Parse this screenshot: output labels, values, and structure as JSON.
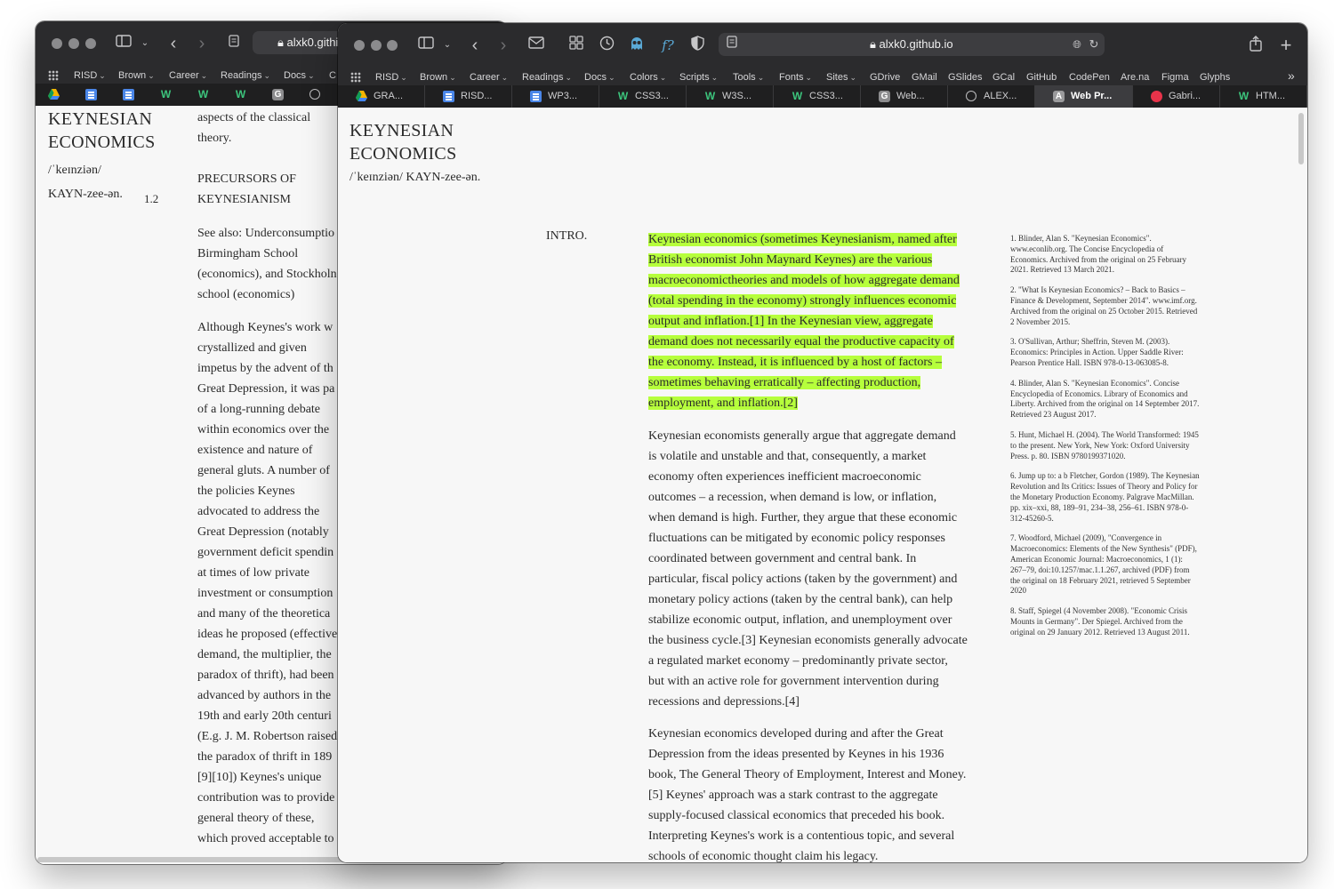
{
  "back_window": {
    "url": "alxk0.githi",
    "bookmarks": [
      "RISD",
      "Brown",
      "Career",
      "Readings",
      "Docs",
      "C"
    ],
    "title_lines": [
      "KEYNESIAN",
      "ECONOMICS"
    ],
    "pronunciation_lines": [
      "/ˈkeɪnziən/",
      "KAYN-zee-ən."
    ],
    "section_number": "1.2",
    "top_lines": [
      "aspects of the classical",
      "theory."
    ],
    "heading_lines": [
      "PRECURSORS OF",
      "KEYNESIANISM"
    ],
    "para1_lines": [
      "See also: Underconsumptio",
      "Birmingham School",
      "(economics), and Stockholn",
      "school (economics)"
    ],
    "para2_lines": [
      "Although Keynes's work w",
      "crystallized and given",
      "impetus by the advent of th",
      "Great Depression, it was pa",
      "of a long-running debate",
      "within economics over the",
      "existence and nature of",
      "general gluts. A number of",
      "the policies Keynes",
      "advocated to address the",
      "Great Depression (notably",
      "government deficit spendin",
      "at times of low private",
      "investment or consumption",
      "and many of the theoretica",
      "ideas he proposed (effective",
      "demand, the multiplier, the",
      "paradox of thrift), had been",
      "advanced by authors in the",
      "19th and early 20th centuri",
      "(E.g. J. M. Robertson raised",
      "the paradox of thrift in 189",
      "[9][10]) Keynes's unique",
      "contribution was to provide",
      "general theory of these,",
      "which proved acceptable to"
    ]
  },
  "front_window": {
    "url": "alxk0.github.io",
    "bookmarks": [
      "RISD",
      "Brown",
      "Career",
      "Readings",
      "Docs",
      "Colors",
      "Scripts",
      "Tools",
      "Fonts",
      "Sites",
      "GDrive",
      "GMail",
      "GSlides",
      "GCal",
      "GitHub",
      "CodePen",
      "Are.na",
      "Figma",
      "Glyphs"
    ],
    "bookmark_has_menu": [
      true,
      true,
      true,
      true,
      true,
      true,
      true,
      true,
      true,
      true,
      false,
      false,
      false,
      false,
      false,
      false,
      false,
      false,
      false
    ],
    "tabs": [
      {
        "label": "GRA...",
        "icon": "google-drive-icon"
      },
      {
        "label": "RISD...",
        "icon": "google-docs-icon"
      },
      {
        "label": "WP3...",
        "icon": "google-docs-icon"
      },
      {
        "label": "CSS3...",
        "icon": "w3schools-icon"
      },
      {
        "label": "W3S...",
        "icon": "w3schools-icon"
      },
      {
        "label": "CSS3...",
        "icon": "w3schools-icon"
      },
      {
        "label": "Web...",
        "icon": "g-letter-icon"
      },
      {
        "label": "ALEX...",
        "icon": "compass-icon"
      },
      {
        "label": "Web Pr...",
        "icon": "a-letter-icon"
      },
      {
        "label": "Gabri...",
        "icon": "red-circle-icon"
      },
      {
        "label": "HTM...",
        "icon": "w3schools-icon"
      }
    ],
    "title_lines": [
      "KEYNESIAN",
      "ECONOMICS"
    ],
    "pronunciation": "/ˈkeɪnziən/ KAYN-zee-ən.",
    "section_label": "INTRO.",
    "highlight_lines": [
      "Keynesian economics (sometimes Keynesianism, named after",
      "British economist John Maynard Keynes) are the various",
      "macroeconomictheories and models of how aggregate demand",
      "(total spending in the economy) strongly influences economic",
      "output and inflation.[1] In the Keynesian view, aggregate",
      "demand does not necessarily equal the productive capacity of",
      "the economy. Instead, it is influenced by a host of factors –",
      "sometimes behaving erratically – affecting production,",
      "employment, and inflation.[2]"
    ],
    "para2_lines": [
      "Keynesian economists generally argue that aggregate demand",
      "is volatile and unstable and that, consequently, a market",
      "economy often experiences inefficient macroeconomic",
      "outcomes – a recession, when demand is low, or inflation,",
      "when demand is high. Further, they argue that these economic",
      "fluctuations can be mitigated by economic policy responses",
      "coordinated between government and central bank. In",
      "particular, fiscal policy actions (taken by the government) and",
      "monetary policy actions (taken by the central bank), can help",
      "stabilize economic output, inflation, and unemployment over",
      "the business cycle.[3] Keynesian economists generally advocate",
      "a regulated market economy – predominantly private sector,",
      "but with an active role for government intervention during",
      "recessions and depressions.[4]"
    ],
    "para3_lines": [
      "Keynesian economics developed during and after the Great",
      "Depression from the ideas presented by Keynes in his 1936",
      "book, The General Theory of Employment, Interest and Money.",
      "[5] Keynes' approach was a stark contrast to the aggregate",
      "supply-focused classical economics that preceded his book.",
      "Interpreting Keynes's work is a contentious topic, and several",
      "schools of economic thought claim his legacy."
    ],
    "references": [
      "1. Blinder, Alan S. \"Keynesian Economics\". www.econlib.org. The Concise Encyclopedia of Economics. Archived from the original on 25 February 2021. Retrieved 13 March 2021.",
      "2. \"What Is Keynesian Economics? – Back to Basics – Finance & Development, September 2014\". www.imf.org. Archived from the original on 25 October 2015. Retrieved 2 November 2015.",
      "3. O'Sullivan, Arthur; Sheffrin, Steven M. (2003). Economics: Principles in Action. Upper Saddle River: Pearson Prentice Hall. ISBN 978-0-13-063085-8.",
      "4. Blinder, Alan S. \"Keynesian Economics\". Concise Encyclopedia of Economics. Library of Economics and Liberty. Archived from the original on 14 September 2017. Retrieved 23 August 2017.",
      "5. Hunt, Michael H. (2004). The World Transformed: 1945 to the present. New York, New York: Oxford University Press. p. 80. ISBN 9780199371020.",
      "6. Jump up to: a b Fletcher, Gordon (1989). The Keynesian Revolution and Its Critics: Issues of Theory and Policy for the Monetary Production Economy. Palgrave MacMillan. pp. xix–xxi, 88, 189–91, 234–38, 256–61. ISBN 978-0-312-45260-5.",
      "7. Woodford, Michael (2009), \"Convergence in Macroeconomics: Elements of the New Synthesis\" (PDF), American Economic Journal: Macroeconomics, 1 (1): 267–79, doi:10.1257/mac.1.1.267, archived (PDF) from the original on 18 February 2021, retrieved 5 September 2020",
      "8. Staff, Spiegel (4 November 2008). \"Economic Crisis Mounts in Germany\". Der Spiegel. Archived from the original on 29 January 2012. Retrieved 13 August 2011."
    ]
  }
}
